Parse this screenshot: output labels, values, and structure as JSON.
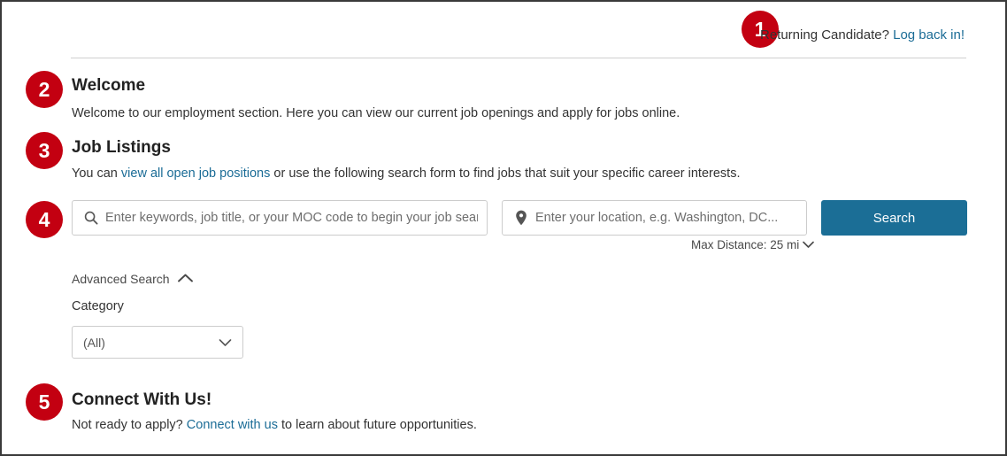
{
  "header": {
    "badge": "1",
    "prompt": "Returning Candidate?",
    "login_link": "Log back in!"
  },
  "welcome": {
    "badge": "2",
    "title": "Welcome",
    "body": "Welcome to our employment section. Here you can view our current job openings and apply for jobs online."
  },
  "job_listings": {
    "badge": "3",
    "title": "Job Listings",
    "body_before": "You can ",
    "link": "view all open job positions",
    "body_after": " or use the following search form to find jobs that suit your specific career interests."
  },
  "search": {
    "badge": "4",
    "keyword_placeholder": "Enter keywords, job title, or your MOC code to begin your job search.",
    "keyword_value": "",
    "location_placeholder": "Enter your location, e.g. Washington, DC...",
    "location_value": "",
    "search_button": "Search",
    "max_distance": "Max Distance: 25 mi",
    "keyword_icon": "search-icon",
    "location_icon": "map-pin-icon"
  },
  "advanced": {
    "toggle_label": "Advanced Search",
    "category_label": "Category",
    "category_value": "(All)"
  },
  "connect": {
    "badge": "5",
    "title": "Connect With Us!",
    "body_before": "Not ready to apply? ",
    "link": "Connect with us",
    "body_after": " to learn about future opportunities."
  },
  "colors": {
    "badge_red": "#c30011",
    "accent_blue": "#1b6e96",
    "link_blue": "#1b6c96",
    "border_gray": "#cccccc",
    "text_dark": "#333333"
  }
}
